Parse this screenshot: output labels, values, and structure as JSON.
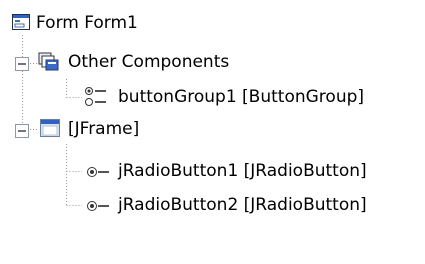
{
  "colors": {
    "tree_line": "#9a9a9a",
    "toggle_border": "#8d9aa6",
    "frame_titlebar": "#2f63c3",
    "window_body": "#d8e4f5",
    "radio_dot": "#3a3a3a",
    "text": "#000000"
  },
  "tree": {
    "root": {
      "label": "Form Form1",
      "icon": "form-icon",
      "expanded": true
    },
    "nodes": [
      {
        "label": "Other Components",
        "icon": "other-components-icon",
        "expanded": true,
        "children": [
          {
            "label": "buttonGroup1 [ButtonGroup]",
            "icon": "button-group-icon"
          }
        ]
      },
      {
        "label": "[JFrame]",
        "icon": "jframe-icon",
        "expanded": true,
        "children": [
          {
            "label": "jRadioButton1 [JRadioButton]",
            "icon": "radio-button-icon"
          },
          {
            "label": "jRadioButton2 [JRadioButton]",
            "icon": "radio-button-icon"
          }
        ]
      }
    ]
  }
}
